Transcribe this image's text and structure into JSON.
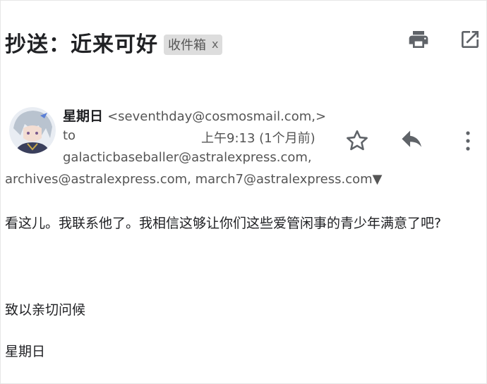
{
  "header": {
    "subject": "抄送：近来可好",
    "label": "收件箱",
    "label_remove": "x",
    "print_icon": "print-icon",
    "open_new_window_icon": "open-in-new-icon"
  },
  "message": {
    "sender_name": "星期日",
    "sender_email": "<seventhday@cosmosmail.com,>",
    "to_label": "to",
    "time": "上午9:13 (1个月前)",
    "recipients_line1": "galacticbaseballer@astralexpress.com,",
    "recipients_line2": "archives@astralexpress.com, march7@astralexpress.com▼",
    "avatar_icon": "avatar",
    "star_icon": "star-icon",
    "reply_icon": "reply-icon",
    "more_icon": "more-vert-icon"
  },
  "body": {
    "text": "看这儿。我联系他了。我相信这够让你们这些爱管闲事的青少年满意了吧?",
    "closing": "致以亲切问候",
    "signature": "星期日"
  },
  "colors": {
    "icon": "#5f6368",
    "chip_bg": "#dddddd",
    "avatar_hair": "#b9c3cf"
  }
}
